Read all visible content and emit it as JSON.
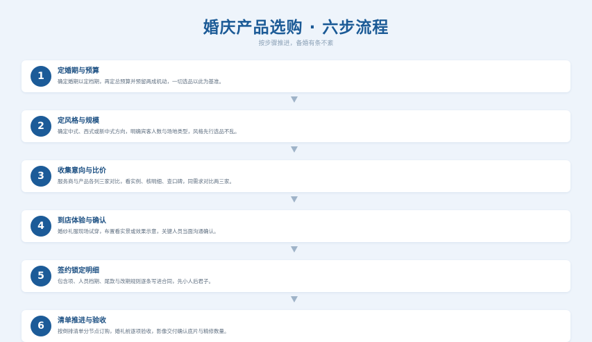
{
  "header": {
    "title": "婚庆产品选购 · 六步流程",
    "subtitle": "按步骤推进，备婚有条不紊"
  },
  "steps": [
    {
      "number": "1",
      "title": "定婚期与预算",
      "description": "确定婚期以定档期，再定总预算并预留两成机动，一切选品以此为基准。"
    },
    {
      "number": "2",
      "title": "定风格与规模",
      "description": "确定中式、西式或新中式方向，明确宾客人数与场地类型，风格先行选品不乱。"
    },
    {
      "number": "3",
      "title": "收集意向与比价",
      "description": "服务商与产品各列三家对比，看实例、核明细、查口碑，同需求对比两三家。"
    },
    {
      "number": "4",
      "title": "到店体验与确认",
      "description": "婚纱礼服现场试穿，布置看实景或效果示意，关键人员当面沟通确认。"
    },
    {
      "number": "5",
      "title": "签约锁定明细",
      "description": "包含项、人员档期、尾款与改期规则逐条写进合同，先小人后君子。"
    },
    {
      "number": "6",
      "title": "清单推进与验收",
      "description": "按倒排清单分节点订购，婚礼前逐项验收，影像交付确认底片与精修数量。"
    }
  ],
  "colors": {
    "background": "#eef4fb",
    "accent": "#1c5b98",
    "arrow": "#9fb3c8"
  },
  "icons": {
    "connector": "down-triangle-arrow-icon"
  }
}
